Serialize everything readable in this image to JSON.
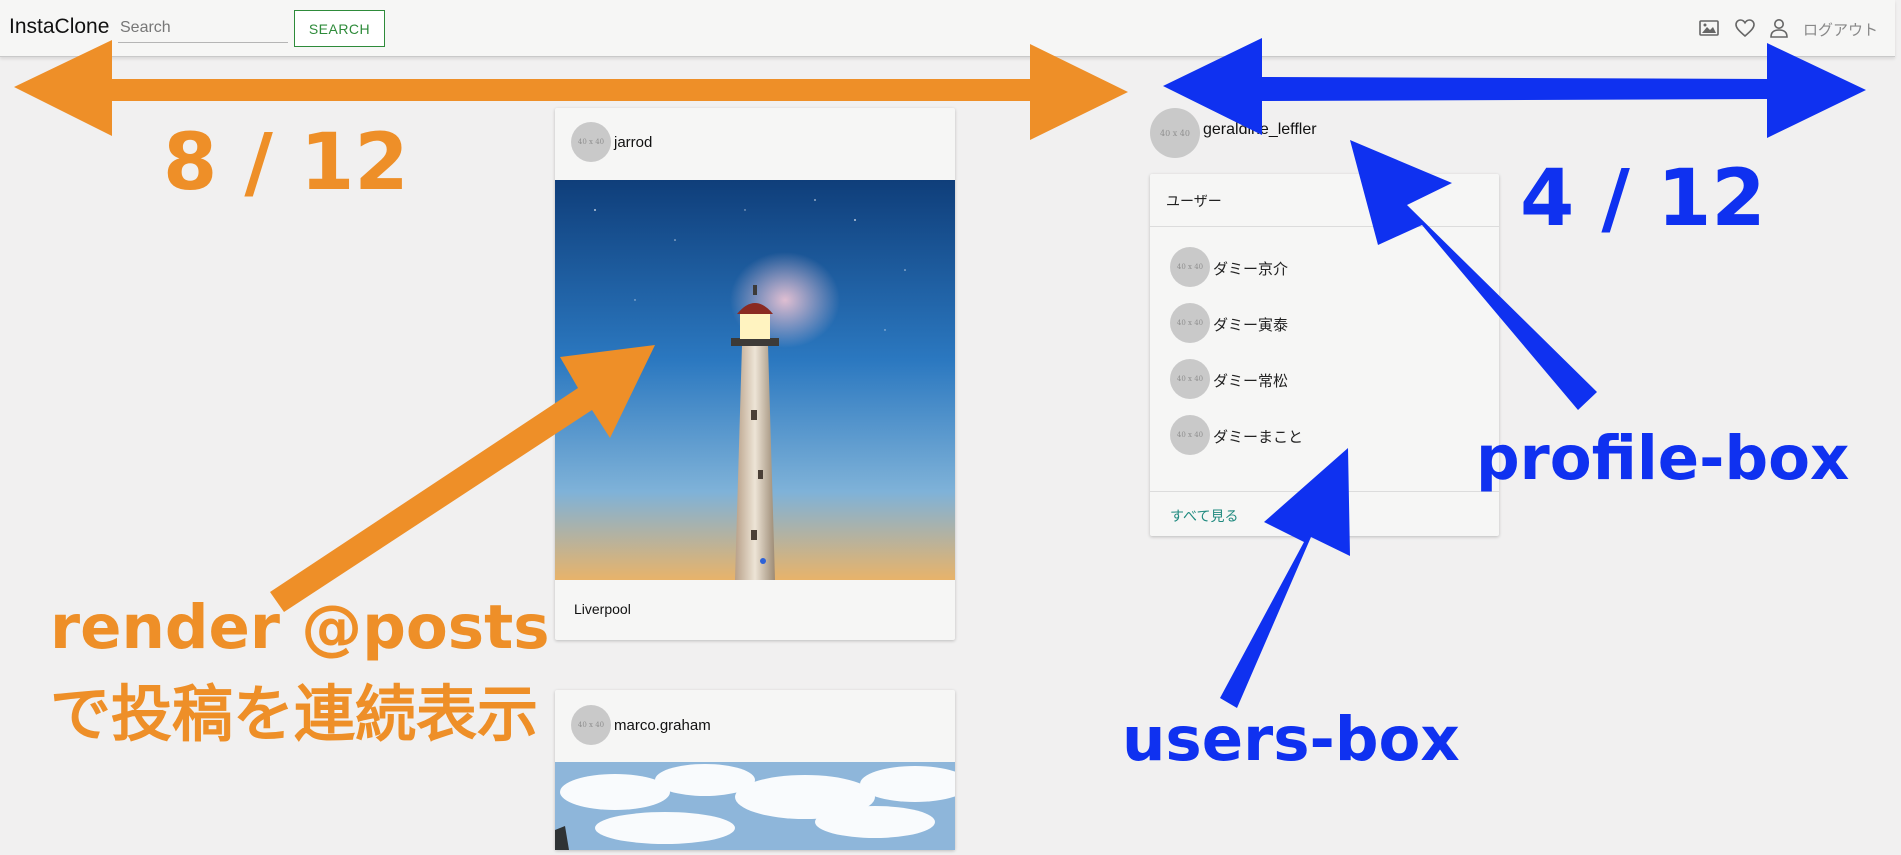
{
  "navbar": {
    "brand": "InstaClone",
    "search_placeholder": "Search",
    "search_button": "SEARCH",
    "logout": "ログアウト",
    "icons": [
      "image-icon",
      "heart-icon",
      "user-icon"
    ]
  },
  "posts": [
    {
      "user": "jarrod",
      "avatar_text": "40 x 40",
      "caption": "Liverpool"
    },
    {
      "user": "marco.graham",
      "avatar_text": "40 x 40"
    }
  ],
  "profile": {
    "user": "geraldine_leffler",
    "avatar_text": "40 x 40"
  },
  "users_box": {
    "header": "ユーザー",
    "users": [
      {
        "name": "ダミー京介",
        "avatar_text": "40 x 40"
      },
      {
        "name": "ダミー寅泰",
        "avatar_text": "40 x 40"
      },
      {
        "name": "ダミー常松",
        "avatar_text": "40 x 40"
      },
      {
        "name": "ダミーまこと",
        "avatar_text": "40 x 40"
      }
    ],
    "see_all": "すべて見る"
  },
  "annotations": {
    "left_ratio": "8 / 12",
    "right_ratio": "4 / 12",
    "render_line1": "render @posts",
    "render_line2": "で投稿を連続表示",
    "profile_box": "profile-box",
    "users_box": "users-box"
  },
  "colors": {
    "annotation_orange": "#ee8f28",
    "annotation_blue": "#0f31f0",
    "search_green": "#2e8b3a",
    "link_teal": "#1f8a7f"
  }
}
